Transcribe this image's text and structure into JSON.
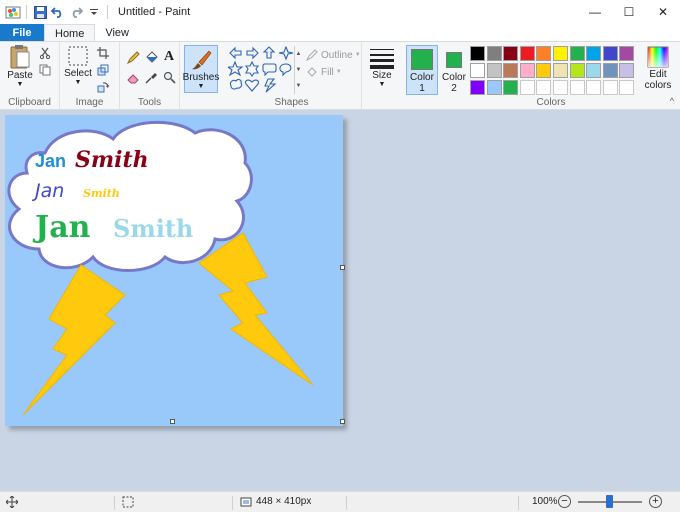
{
  "window": {
    "title": "Untitled - Paint",
    "controls": {
      "minimize": "—",
      "maximize": "☐",
      "close": "✕"
    }
  },
  "tabs": {
    "file": "File",
    "home": "Home",
    "view": "View"
  },
  "ribbon": {
    "clipboard": {
      "label": "Clipboard",
      "paste": "Paste"
    },
    "image": {
      "label": "Image",
      "select": "Select"
    },
    "tools": {
      "label": "Tools"
    },
    "brushes": {
      "label": "Brushes"
    },
    "shapes": {
      "label": "Shapes",
      "outline": "Outline",
      "fill": "Fill"
    },
    "size": {
      "label": "Size"
    },
    "color1": {
      "label": "Color",
      "num": "1",
      "color": "#22b14c"
    },
    "color2": {
      "label": "Color",
      "num": "2",
      "color": "#22b14c"
    },
    "colors": {
      "label": "Colors",
      "row1": [
        "#000000",
        "#7f7f7f",
        "#880015",
        "#ed1c24",
        "#ff7f27",
        "#fff200",
        "#22b14c",
        "#00a2e8",
        "#3f48cc",
        "#a349a4"
      ],
      "row2": [
        "#ffffff",
        "#c3c3c3",
        "#b97a57",
        "#ffaec9",
        "#ffc90e",
        "#efe4b0",
        "#b5e61d",
        "#99d9ea",
        "#7092be",
        "#c8bfe7"
      ],
      "row3": [
        "#8000ff",
        "#99c8fb",
        "#22b14c"
      ]
    },
    "edit_colors": {
      "line1": "Edit",
      "line2": "colors"
    }
  },
  "canvas": {
    "background": "#99c8fb",
    "texts": [
      {
        "first": "Jan",
        "last": "Smith"
      },
      {
        "first": "Jan",
        "last": "Smith"
      },
      {
        "first": "Jan",
        "last": "Smith"
      }
    ]
  },
  "status": {
    "dimensions": "448 × 410px",
    "zoom": "100%"
  }
}
